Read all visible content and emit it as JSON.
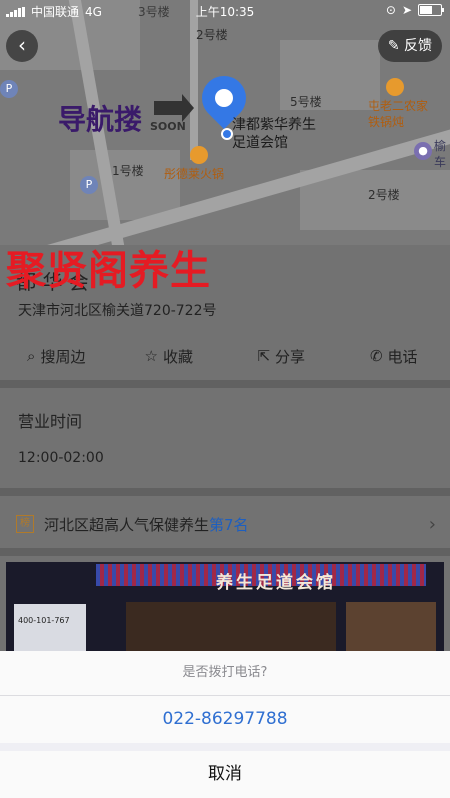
{
  "status_bar": {
    "carrier": "中国联通",
    "network": "4G",
    "time": "上午10:35",
    "bg_building": "3号楼"
  },
  "map": {
    "building_labels": [
      "2号楼",
      "5号楼",
      "1号楼",
      "2号楼"
    ],
    "place_name": "津都紫华养生足道会馆",
    "pois": [
      {
        "label": "彤德莱火锅",
        "icon": "food-icon"
      },
      {
        "label": "屯老二农家铁锅炖",
        "icon": "food-icon"
      },
      {
        "label": "榆车",
        "icon": "pin-icon"
      }
    ],
    "feedback_label": "反馈"
  },
  "overlay": {
    "nav_text": "导航搂",
    "soon_text": "SOON",
    "red_text": "聚贤阁养生"
  },
  "detail": {
    "title_partial": "都 华    会",
    "address": "天津市河北区榆关道720-722号",
    "actions": [
      {
        "label": "搜周边",
        "icon": "search-icon"
      },
      {
        "label": "收藏",
        "icon": "star-icon"
      },
      {
        "label": "分享",
        "icon": "share-icon"
      },
      {
        "label": "电话",
        "icon": "phone-icon"
      }
    ],
    "hours_title": "营业时间",
    "hours_value": "12:00-02:00",
    "rank": {
      "badge": "榜",
      "text": "河北区超高人气保健养生",
      "position": "第7名"
    }
  },
  "photo": {
    "sign_text": "养生足道会馆",
    "board_text": "400-101-767"
  },
  "call_sheet": {
    "prompt": "是否拨打电话?",
    "phone": "022-86297788",
    "cancel": "取消"
  },
  "colors": {
    "link_blue": "#2f6fd1",
    "overlay_red": "#e51b23",
    "pin_blue": "#3478e5"
  }
}
